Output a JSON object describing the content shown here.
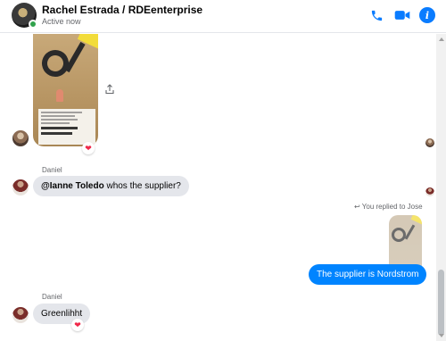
{
  "header": {
    "title": "Rachel Estrada / RDEenterprise",
    "status": "Active now"
  },
  "colors": {
    "accent": "#0084ff",
    "online": "#31a24c",
    "incoming_bubble": "#e4e6eb",
    "heart": "#f02849"
  },
  "icons": {
    "call": "phone-icon",
    "video": "video-camera-icon",
    "info": "info-icon",
    "share": "share-icon",
    "reply": "reply-arrow-icon",
    "reaction": "heart-icon"
  },
  "messages": [
    {
      "sender": "",
      "type": "image",
      "reaction": "❤"
    },
    {
      "sender": "Daniel",
      "type": "text",
      "mention": "@Ianne Toledo",
      "text": " whos the supplier?"
    },
    {
      "type": "reply_note",
      "text": "You replied to Jose"
    },
    {
      "type": "text_out",
      "text": "The supplier is Nordstrom"
    },
    {
      "sender": "Daniel",
      "type": "text",
      "text": "Greenlihht",
      "reaction": "❤"
    }
  ],
  "info_glyph": "i"
}
